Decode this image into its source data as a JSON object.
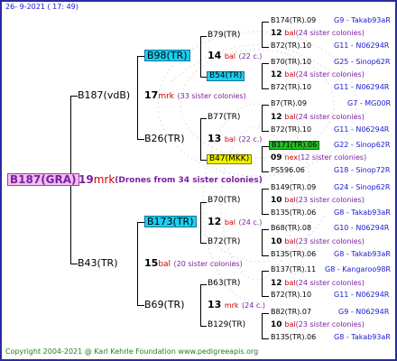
{
  "date": "26-  9-2021 ( 17: 49)",
  "root": "B187(GRA)",
  "root_mark": "19",
  "root_unit": "mrk",
  "root_note": "(Drones from 34 sister colonies)",
  "g1": [
    {
      "id": "B187(vdB)",
      "n": "17",
      "u": "mrk",
      "note": "(33 sister colonies)"
    },
    {
      "id": "B43(TR)",
      "n": "15",
      "u": "bal",
      "note": "(20 sister colonies)"
    }
  ],
  "g2": [
    {
      "id": "B98(TR)",
      "n": "14",
      "u": "bal",
      "note": "(22 c.)"
    },
    {
      "id": "B26(TR)",
      "n": "13",
      "u": "bal",
      "note": "(22 c.)"
    },
    {
      "id": "B173(TR)",
      "n": "12",
      "u": "bal",
      "note": "(24 c.)"
    },
    {
      "id": "B69(TR)",
      "n": "13",
      "u": "mrk",
      "note": "(24 c.)"
    }
  ],
  "g3": [
    {
      "id": "B79(TR)",
      "n": "12",
      "u": "bal",
      "note": "(24 sister colonies)"
    },
    {
      "id": "B54(TR)",
      "n": "12",
      "u": "bal",
      "note": "(24 sister colonies)"
    },
    {
      "id": "B77(TR)",
      "n": "12",
      "u": "bal",
      "note": "(24 sister colonies)"
    },
    {
      "id": "B47(MKK)",
      "n": "09",
      "u": "nex",
      "note": "(12 sister colonies)"
    },
    {
      "id": "B70(TR)",
      "n": "10",
      "u": "bal",
      "note": "(23 sister colonies)"
    },
    {
      "id": "B72(TR)",
      "n": "10",
      "u": "bal",
      "note": "(23 sister colonies)"
    },
    {
      "id": "B63(TR)",
      "n": "12",
      "u": "bal",
      "note": "(24 sister colonies)"
    },
    {
      "id": "B129(TR)",
      "n": "10",
      "u": "bal",
      "note": "(23 sister colonies)"
    }
  ],
  "g4": [
    {
      "id": "B174(TR).09",
      "code": "G9 - Takab93aR"
    },
    {
      "id": "B72(TR).10",
      "code": "G11 - N06294R"
    },
    {
      "id": "B70(TR).10",
      "code": "G25 - Sinop62R"
    },
    {
      "id": "B72(TR).10",
      "code": "G11 - N06294R"
    },
    {
      "id": "B7(TR).09",
      "code": "G7 - MG00R"
    },
    {
      "id": "B72(TR).10",
      "code": "G11 - N06294R"
    },
    {
      "id": "B171(TR).06",
      "code": "G22 - Sinop62R"
    },
    {
      "id": "PS596.06",
      "code": "G18 - Sinop72R"
    },
    {
      "id": "B149(TR).09",
      "code": "G24 - Sinop62R"
    },
    {
      "id": "B135(TR).06",
      "code": "G8 - Takab93aR"
    },
    {
      "id": "B68(TR).08",
      "code": "G10 - N06294R"
    },
    {
      "id": "B135(TR).06",
      "code": "G8 - Takab93aR"
    },
    {
      "id": "B137(TR).11",
      "code": "G8 - Kangaroo98R"
    },
    {
      "id": "B72(TR).10",
      "code": "G11 - N06294R"
    },
    {
      "id": "B82(TR).07",
      "code": "G9 - N06294R"
    },
    {
      "id": "B135(TR).06",
      "code": "G8 - Takab93aR"
    }
  ],
  "footer": "Copyright 2004-2021 @ Karl Kehrle Foundation    www.pedigreeapis.org"
}
